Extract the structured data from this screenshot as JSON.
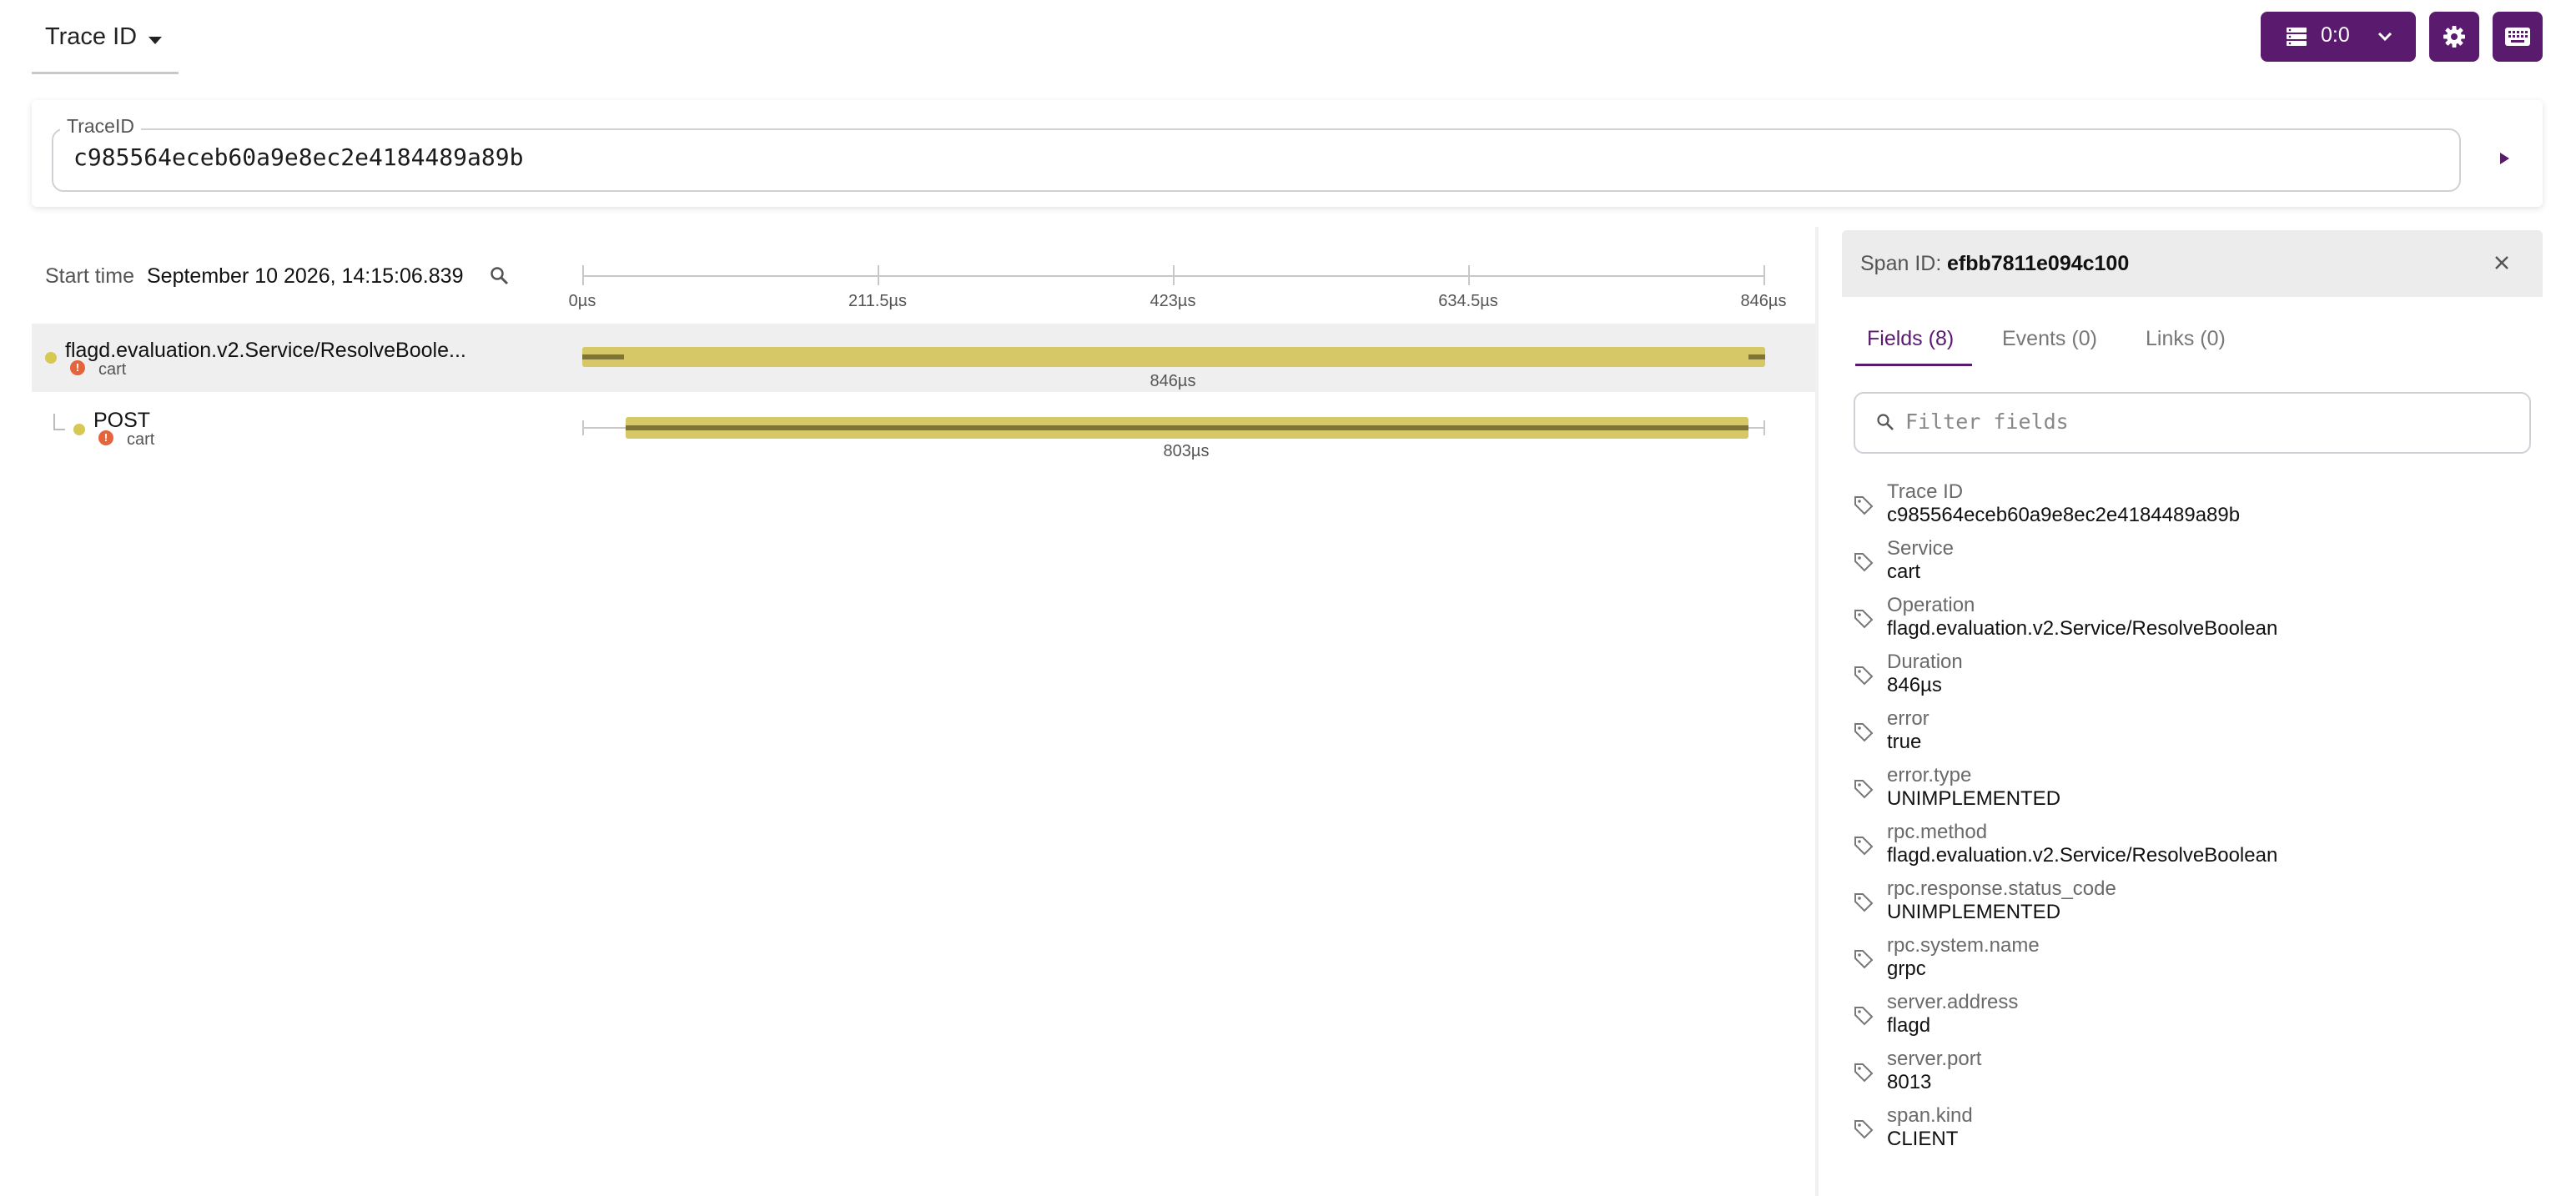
{
  "header": {
    "mode_label": "Trace ID",
    "zoom_value": "0:0"
  },
  "search": {
    "legend": "TraceID",
    "trace_id": "c985564eceb60a9e8ec2e4184489a89b"
  },
  "timeline": {
    "start_label": "Start time",
    "start_value": "September 10 2026, 14:15:06.839",
    "ticks": [
      "0µs",
      "211.5µs",
      "423µs",
      "634.5µs",
      "846µs"
    ],
    "spans": [
      {
        "operation": "flagd.evaluation.v2.Service/ResolveBoole...",
        "service": "cart",
        "duration": "846µs",
        "error": true,
        "selected": true
      },
      {
        "operation": "POST",
        "service": "cart",
        "duration": "803µs",
        "error": true,
        "selected": false
      }
    ]
  },
  "detail": {
    "span_id_label": "Span ID:",
    "span_id": "efbb7811e094c100",
    "tabs": [
      {
        "label": "Fields (8)",
        "active": true
      },
      {
        "label": "Events (0)",
        "active": false
      },
      {
        "label": "Links (0)",
        "active": false
      }
    ],
    "filter_placeholder": "Filter fields",
    "fields": [
      {
        "name": "Trace ID",
        "value": "c985564eceb60a9e8ec2e4184489a89b"
      },
      {
        "name": "Service",
        "value": "cart"
      },
      {
        "name": "Operation",
        "value": "flagd.evaluation.v2.Service/ResolveBoolean"
      },
      {
        "name": "Duration",
        "value": "846µs"
      },
      {
        "name": "error",
        "value": "true"
      },
      {
        "name": "error.type",
        "value": "UNIMPLEMENTED"
      },
      {
        "name": "rpc.method",
        "value": "flagd.evaluation.v2.Service/ResolveBoolean"
      },
      {
        "name": "rpc.response.status_code",
        "value": "UNIMPLEMENTED"
      },
      {
        "name": "rpc.system.name",
        "value": "grpc"
      },
      {
        "name": "server.address",
        "value": "flagd"
      },
      {
        "name": "server.port",
        "value": "8013"
      },
      {
        "name": "span.kind",
        "value": "CLIENT"
      }
    ]
  },
  "colors": {
    "accent": "#5a1b6e",
    "span_bar": "#d6c866",
    "span_bar_dark": "#7e7438",
    "error": "#e4643c",
    "service_dot": "#d6c853"
  }
}
